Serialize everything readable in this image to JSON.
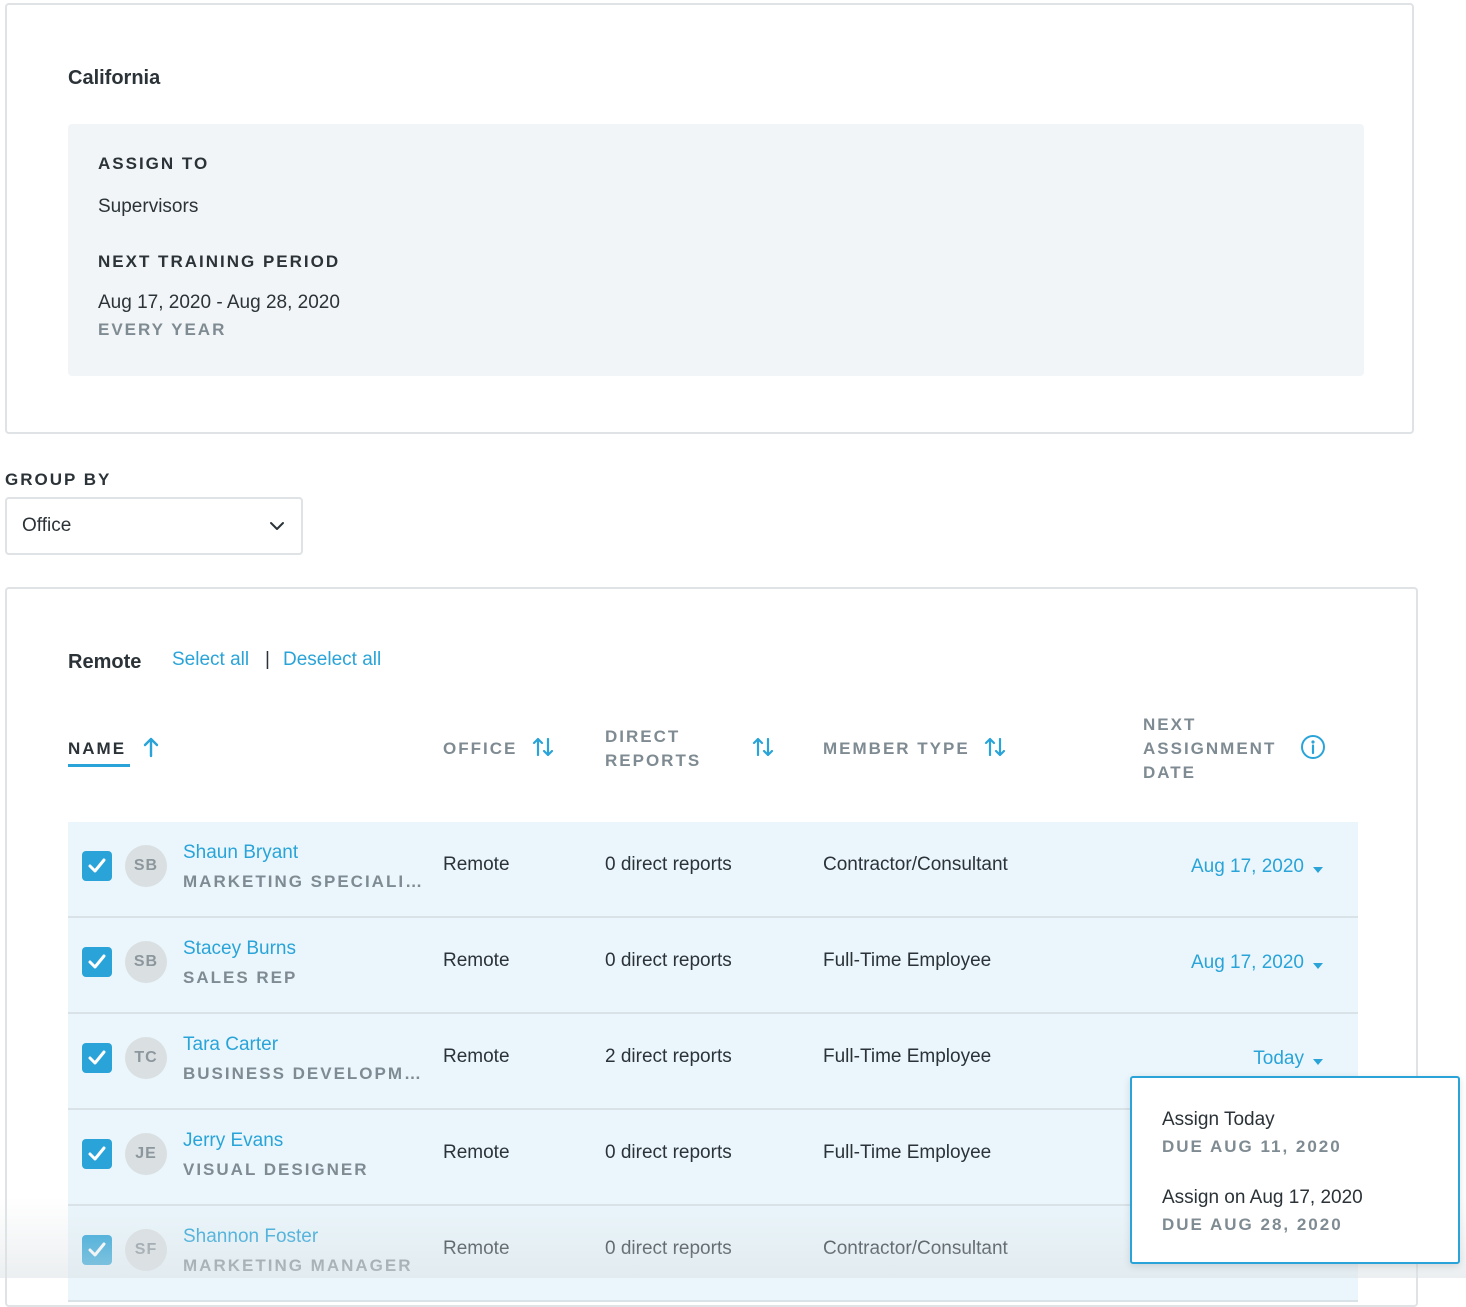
{
  "location": {
    "title": "California",
    "assign_to_label": "ASSIGN TO",
    "assign_to_value": "Supervisors",
    "training_period_label": "NEXT TRAINING PERIOD",
    "training_period_value": "Aug 17, 2020 - Aug 28, 2020",
    "recurrence": "EVERY YEAR"
  },
  "group_by": {
    "label": "GROUP BY",
    "selected": "Office"
  },
  "group": {
    "name": "Remote",
    "select_all": "Select all",
    "separator": "|",
    "deselect_all": "Deselect all"
  },
  "table": {
    "headers": {
      "name": "NAME",
      "office": "OFFICE",
      "direct_reports_1": "DIRECT",
      "direct_reports_2": "REPORTS",
      "member_type": "MEMBER TYPE",
      "next_date_1": "NEXT",
      "next_date_2": "ASSIGNMENT",
      "next_date_3": "DATE"
    },
    "rows": [
      {
        "initials": "SB",
        "name": "Shaun Bryant",
        "title": "MARKETING SPECIALIST",
        "office": "Remote",
        "reports": "0 direct reports",
        "member_type": "Contractor/Consultant",
        "date": "Aug 17, 2020",
        "checked": true
      },
      {
        "initials": "SB",
        "name": "Stacey Burns",
        "title": "SALES REP",
        "office": "Remote",
        "reports": "0 direct reports",
        "member_type": "Full-Time Employee",
        "date": "Aug 17, 2020",
        "checked": true
      },
      {
        "initials": "TC",
        "name": "Tara Carter",
        "title": "BUSINESS DEVELOPMENT",
        "office": "Remote",
        "reports": "2 direct reports",
        "member_type": "Full-Time Employee",
        "date": "Today",
        "checked": true
      },
      {
        "initials": "JE",
        "name": "Jerry Evans",
        "title": "VISUAL DESIGNER",
        "office": "Remote",
        "reports": "0 direct reports",
        "member_type": "Full-Time Employee",
        "date": "",
        "checked": true
      },
      {
        "initials": "SF",
        "name": "Shannon Foster",
        "title": "MARKETING MANAGER",
        "office": "Remote",
        "reports": "0 direct reports",
        "member_type": "Contractor/Consultant",
        "date": "",
        "checked": true
      }
    ]
  },
  "date_popover": {
    "options": [
      {
        "label": "Assign Today",
        "due": "DUE AUG 11, 2020"
      },
      {
        "label": "Assign on Aug 17, 2020",
        "due": "DUE AUG 28, 2020"
      }
    ]
  },
  "colors": {
    "accent": "#2aa4d8",
    "row_bg": "#eaf6fc",
    "panel_bg": "#f1f5f7",
    "text": "#2b3338",
    "muted": "#7f8b92"
  }
}
